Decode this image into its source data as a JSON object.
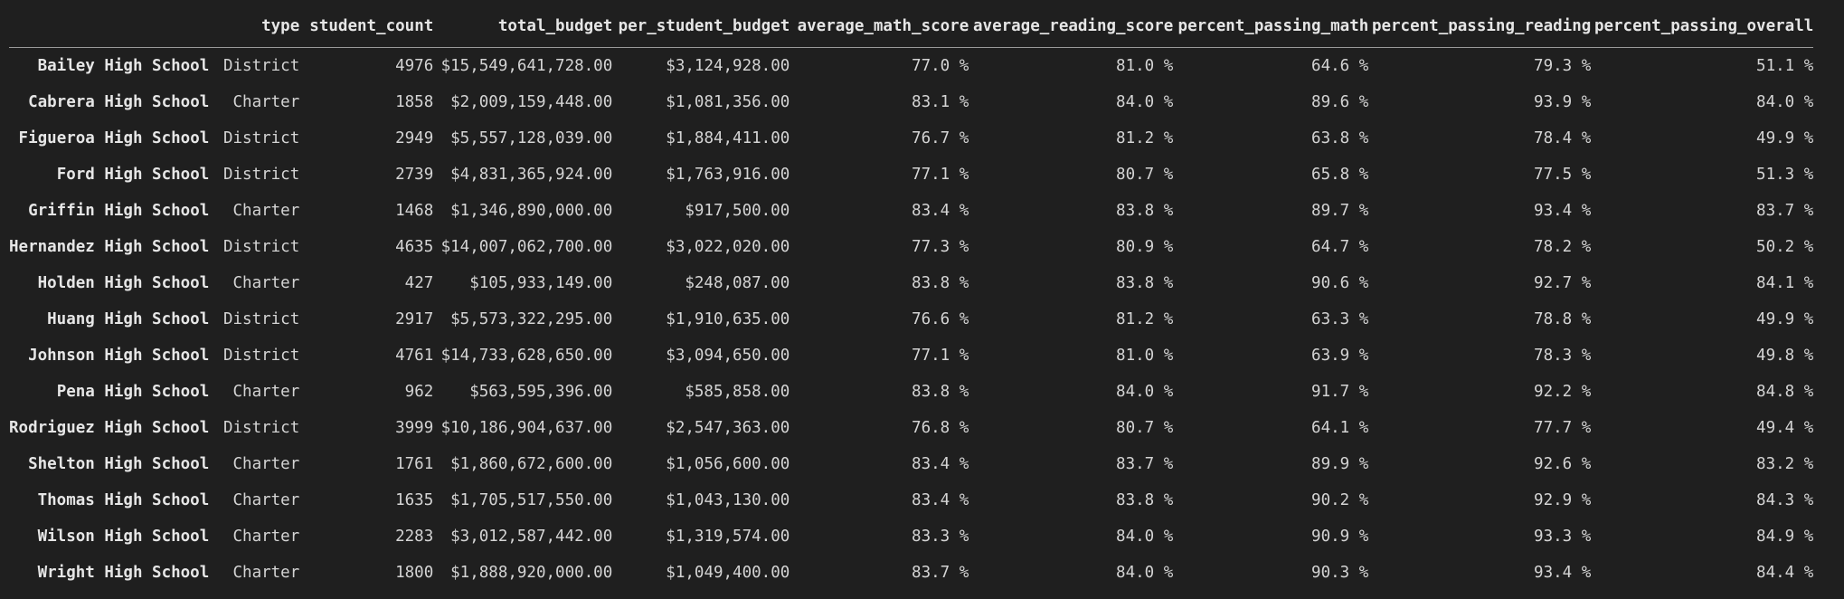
{
  "columns": [
    "",
    "type",
    "student_count",
    "total_budget",
    "per_student_budget",
    "average_math_score",
    "average_reading_score",
    "percent_passing_math",
    "percent_passing_reading",
    "percent_passing_overall"
  ],
  "rows": [
    {
      "name": "Bailey High School",
      "cells": [
        "District",
        "4976",
        "$15,549,641,728.00",
        "$3,124,928.00",
        "77.0 %",
        "81.0 %",
        "64.6 %",
        "79.3 %",
        "51.1 %"
      ]
    },
    {
      "name": "Cabrera High School",
      "cells": [
        "Charter",
        "1858",
        "$2,009,159,448.00",
        "$1,081,356.00",
        "83.1 %",
        "84.0 %",
        "89.6 %",
        "93.9 %",
        "84.0 %"
      ]
    },
    {
      "name": "Figueroa High School",
      "cells": [
        "District",
        "2949",
        "$5,557,128,039.00",
        "$1,884,411.00",
        "76.7 %",
        "81.2 %",
        "63.8 %",
        "78.4 %",
        "49.9 %"
      ]
    },
    {
      "name": "Ford High School",
      "cells": [
        "District",
        "2739",
        "$4,831,365,924.00",
        "$1,763,916.00",
        "77.1 %",
        "80.7 %",
        "65.8 %",
        "77.5 %",
        "51.3 %"
      ]
    },
    {
      "name": "Griffin High School",
      "cells": [
        "Charter",
        "1468",
        "$1,346,890,000.00",
        "$917,500.00",
        "83.4 %",
        "83.8 %",
        "89.7 %",
        "93.4 %",
        "83.7 %"
      ]
    },
    {
      "name": "Hernandez High School",
      "cells": [
        "District",
        "4635",
        "$14,007,062,700.00",
        "$3,022,020.00",
        "77.3 %",
        "80.9 %",
        "64.7 %",
        "78.2 %",
        "50.2 %"
      ]
    },
    {
      "name": "Holden High School",
      "cells": [
        "Charter",
        "427",
        "$105,933,149.00",
        "$248,087.00",
        "83.8 %",
        "83.8 %",
        "90.6 %",
        "92.7 %",
        "84.1 %"
      ]
    },
    {
      "name": "Huang High School",
      "cells": [
        "District",
        "2917",
        "$5,573,322,295.00",
        "$1,910,635.00",
        "76.6 %",
        "81.2 %",
        "63.3 %",
        "78.8 %",
        "49.9 %"
      ]
    },
    {
      "name": "Johnson High School",
      "cells": [
        "District",
        "4761",
        "$14,733,628,650.00",
        "$3,094,650.00",
        "77.1 %",
        "81.0 %",
        "63.9 %",
        "78.3 %",
        "49.8 %"
      ]
    },
    {
      "name": "Pena High School",
      "cells": [
        "Charter",
        "962",
        "$563,595,396.00",
        "$585,858.00",
        "83.8 %",
        "84.0 %",
        "91.7 %",
        "92.2 %",
        "84.8 %"
      ]
    },
    {
      "name": "Rodriguez High School",
      "cells": [
        "District",
        "3999",
        "$10,186,904,637.00",
        "$2,547,363.00",
        "76.8 %",
        "80.7 %",
        "64.1 %",
        "77.7 %",
        "49.4 %"
      ]
    },
    {
      "name": "Shelton High School",
      "cells": [
        "Charter",
        "1761",
        "$1,860,672,600.00",
        "$1,056,600.00",
        "83.4 %",
        "83.7 %",
        "89.9 %",
        "92.6 %",
        "83.2 %"
      ]
    },
    {
      "name": "Thomas High School",
      "cells": [
        "Charter",
        "1635",
        "$1,705,517,550.00",
        "$1,043,130.00",
        "83.4 %",
        "83.8 %",
        "90.2 %",
        "92.9 %",
        "84.3 %"
      ]
    },
    {
      "name": "Wilson High School",
      "cells": [
        "Charter",
        "2283",
        "$3,012,587,442.00",
        "$1,319,574.00",
        "83.3 %",
        "84.0 %",
        "90.9 %",
        "93.3 %",
        "84.9 %"
      ]
    },
    {
      "name": "Wright High School",
      "cells": [
        "Charter",
        "1800",
        "$1,888,920,000.00",
        "$1,049,400.00",
        "83.7 %",
        "84.0 %",
        "90.3 %",
        "93.4 %",
        "84.4 %"
      ]
    }
  ]
}
